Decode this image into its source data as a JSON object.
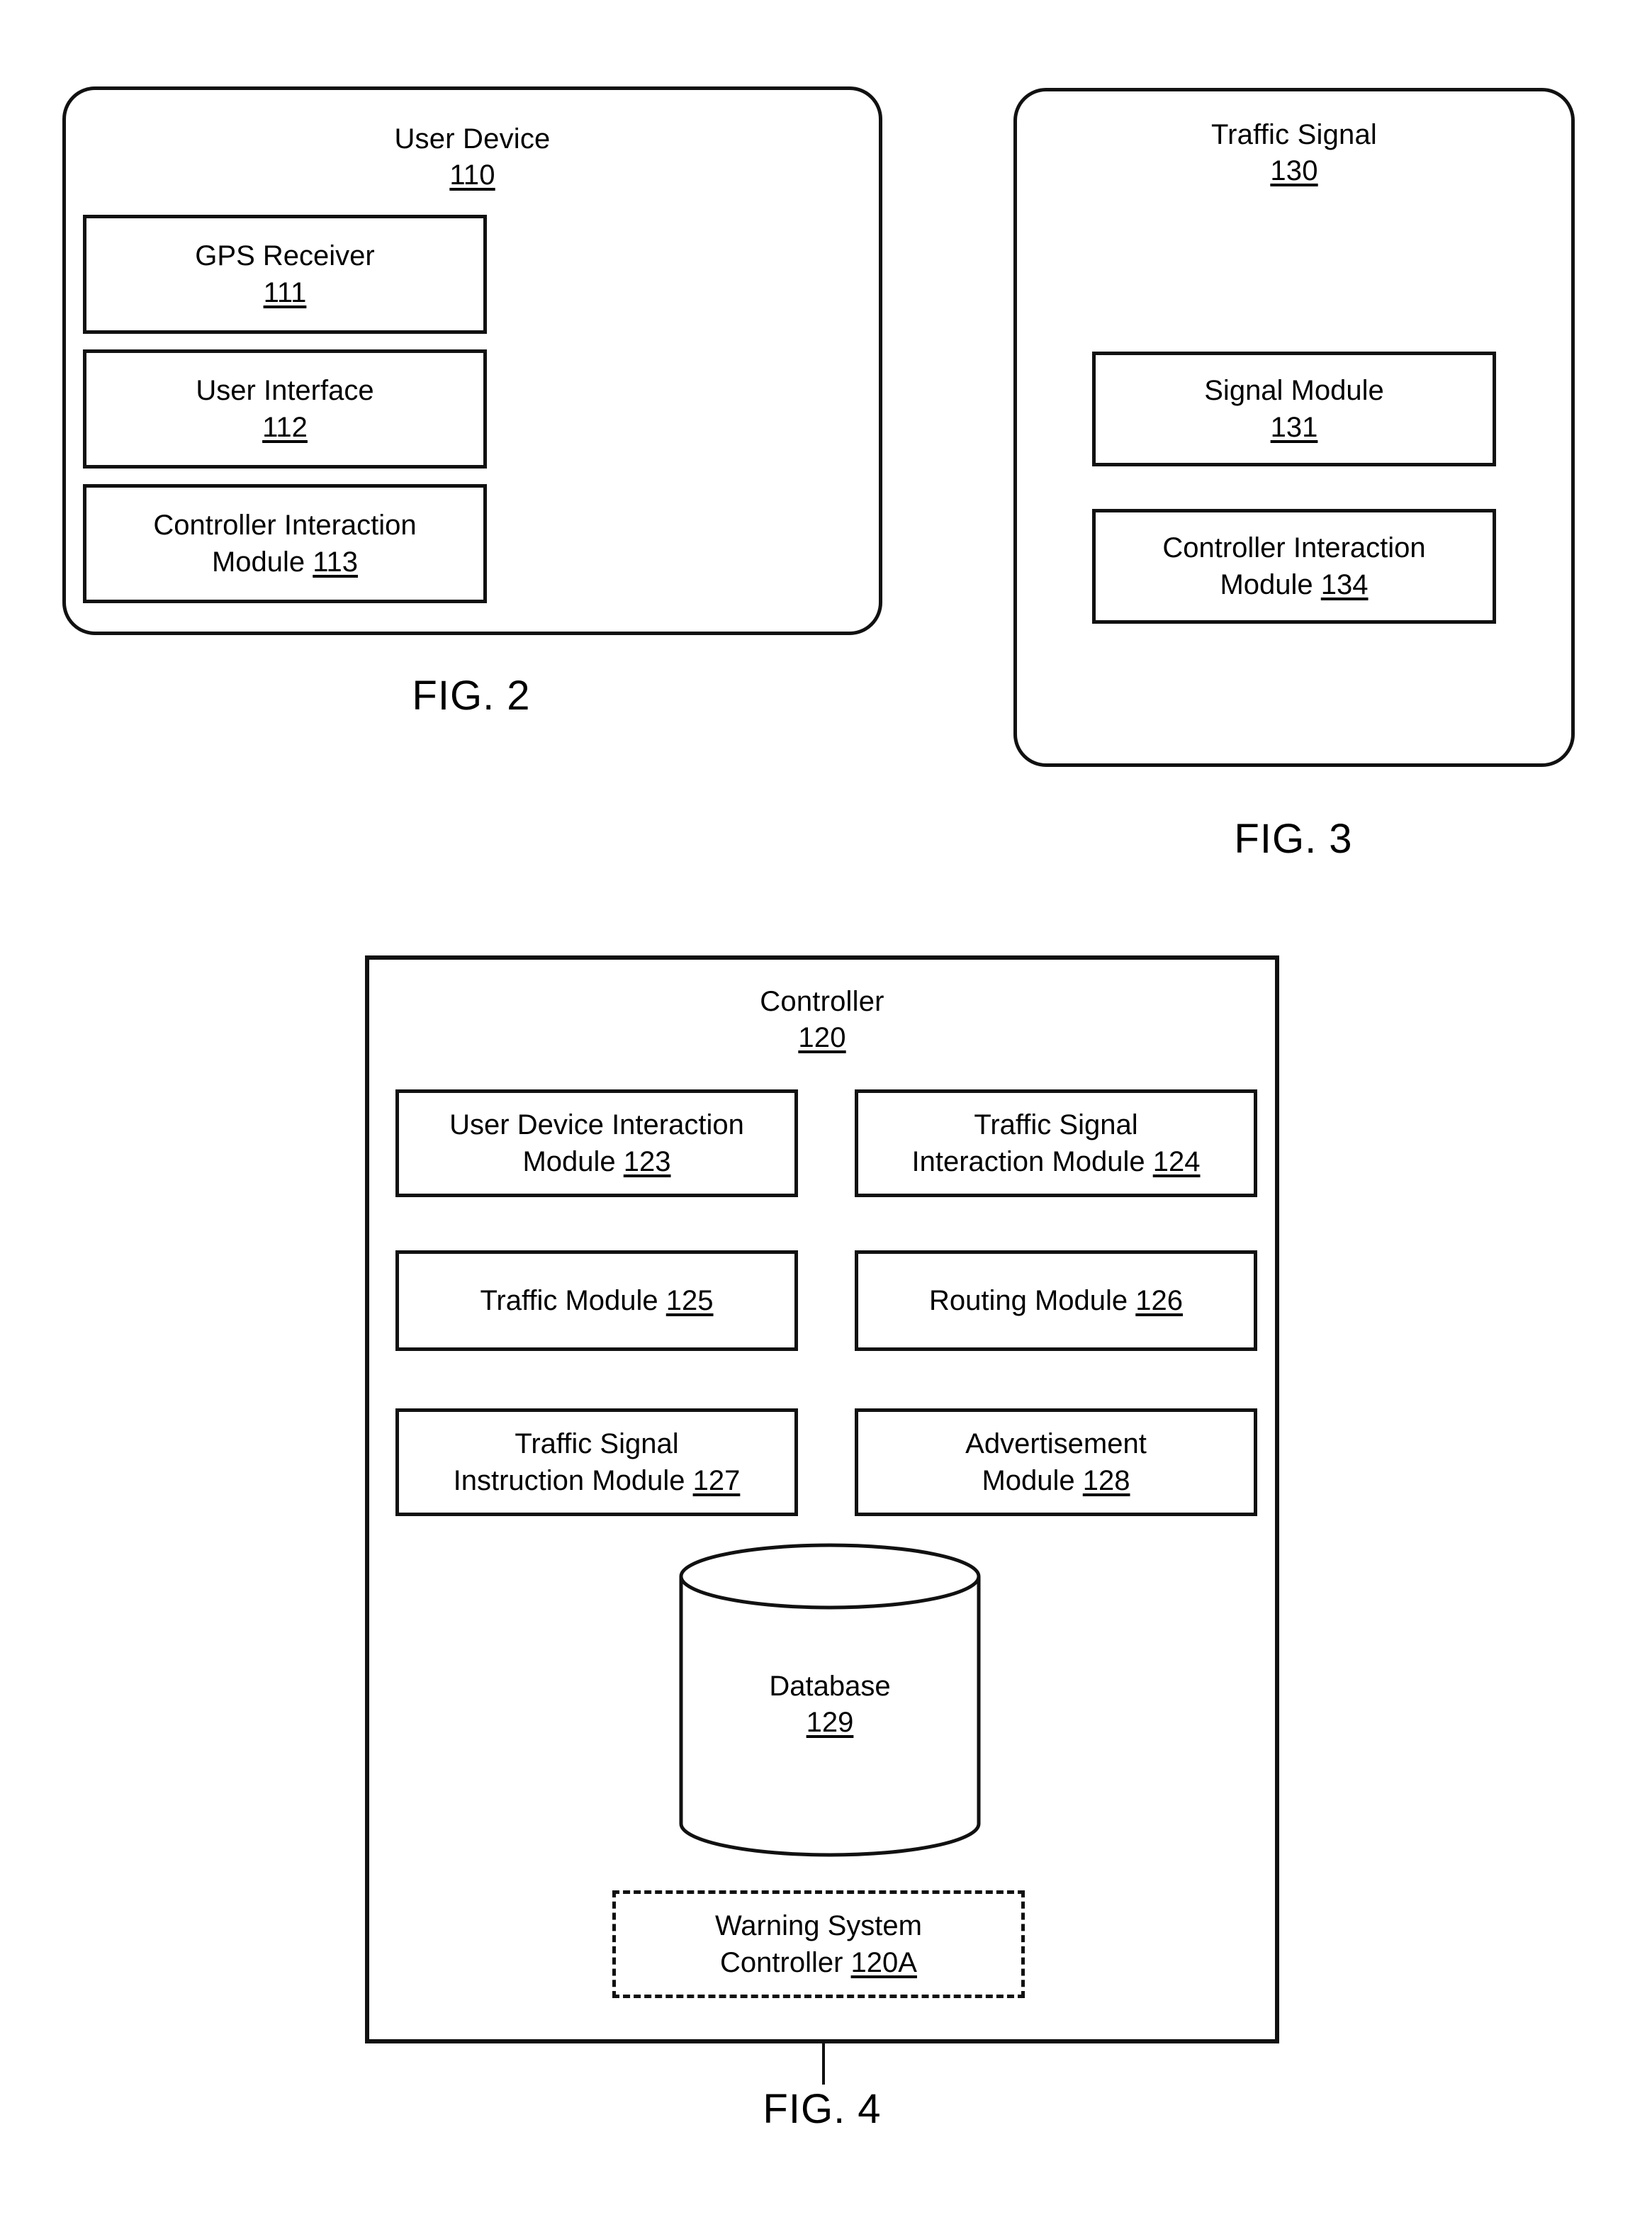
{
  "figures": [
    {
      "id": "fig2",
      "caption": "FIG. 2",
      "title": "User Device",
      "ref": "110",
      "modules": [
        {
          "line1": "GPS Receiver",
          "line2": "",
          "ref": "111",
          "ref_inline": false
        },
        {
          "line1": "User Interface",
          "line2": "",
          "ref": "112",
          "ref_inline": false
        },
        {
          "line1": "Controller Interaction",
          "line2": "Module",
          "ref": "113",
          "ref_inline": true
        }
      ]
    },
    {
      "id": "fig3",
      "caption": "FIG. 3",
      "title": "Traffic Signal",
      "ref": "130",
      "modules": [
        {
          "line1": "Signal Module",
          "line2": "",
          "ref": "131",
          "ref_inline": false
        },
        {
          "line1": "Controller Interaction",
          "line2": "Module",
          "ref": "134",
          "ref_inline": true
        }
      ]
    },
    {
      "id": "fig4",
      "caption": "FIG. 4",
      "title": "Controller",
      "ref": "120",
      "modules": [
        {
          "line1": "User Device Interaction",
          "line2": "Module",
          "ref": "123",
          "ref_inline": true
        },
        {
          "line1": "Traffic Signal",
          "line2": "Interaction Module",
          "ref": "124",
          "ref_inline": true
        },
        {
          "line1": "Traffic Module",
          "line2": "",
          "ref": "125",
          "ref_inline": true
        },
        {
          "line1": "Routing Module",
          "line2": "",
          "ref": "126",
          "ref_inline": true
        },
        {
          "line1": "Traffic Signal",
          "line2": "Instruction Module",
          "ref": "127",
          "ref_inline": true
        },
        {
          "line1": "Advertisement",
          "line2": "Module",
          "ref": "128",
          "ref_inline": true
        }
      ],
      "database": {
        "label": "Database",
        "ref": "129"
      },
      "dashed_module": {
        "line1": "Warning System",
        "line2": "Controller",
        "ref": "120A",
        "ref_inline": true
      }
    }
  ]
}
